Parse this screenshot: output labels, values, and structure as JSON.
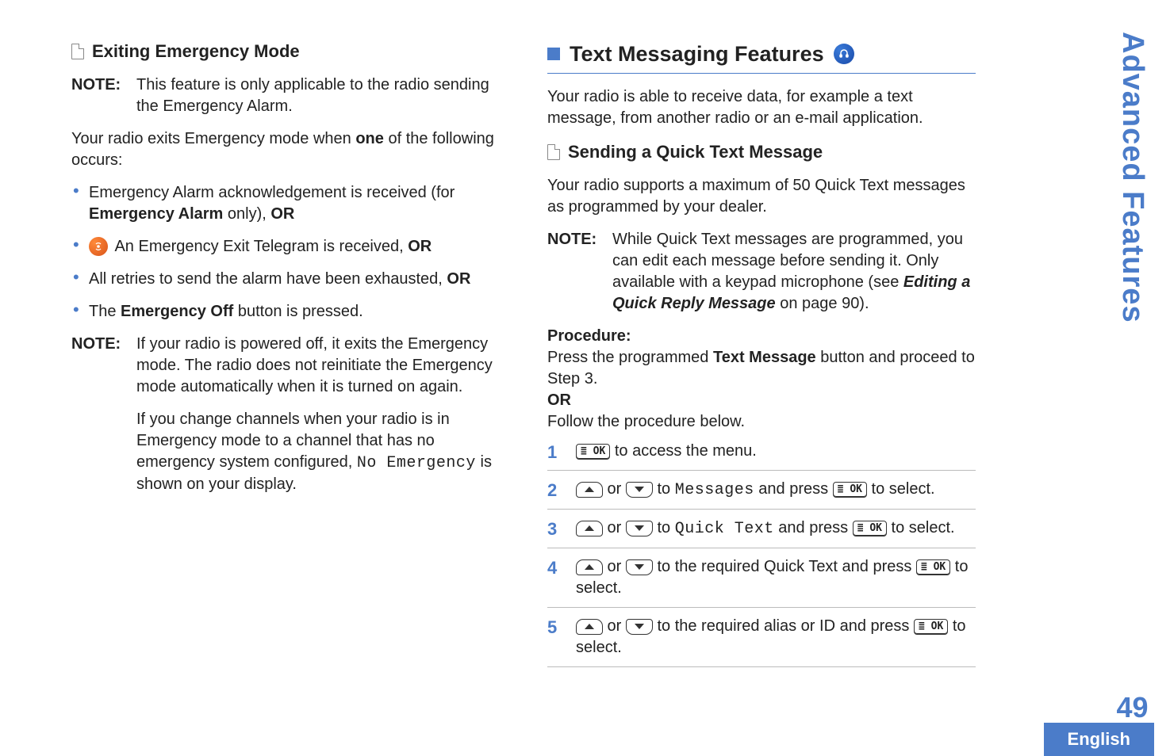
{
  "sidebar": {
    "section_label": "Advanced Features",
    "page_number": "49",
    "language": "English"
  },
  "left": {
    "heading": "Exiting Emergency Mode",
    "note1_label": "NOTE:",
    "note1_body": "This feature is only applicable to the radio sending the Emergency Alarm.",
    "intro_a": "Your radio exits Emergency mode when ",
    "intro_bold": "one",
    "intro_b": " of the following occurs:",
    "b1_a": "Emergency Alarm acknowledgement is received (for ",
    "b1_bold": "Emergency Alarm",
    "b1_b": " only), ",
    "b1_or": "OR",
    "b2_a": " An Emergency Exit Telegram is received, ",
    "b2_or": "OR",
    "b3_a": "All retries to send the alarm have been exhausted, ",
    "b3_or": "OR",
    "b4_a": "The ",
    "b4_bold": "Emergency Off",
    "b4_b": " button is pressed.",
    "note2_label": "NOTE:",
    "note2_p1": "If your radio is powered off, it exits the Emergency mode. The radio does not reinitiate the Emergency mode automatically when it is turned on again.",
    "note2_p2a": "If you change channels when your radio is in Emergency mode to a channel that has no emergency system configured, ",
    "note2_mono": "No Emergency",
    "note2_p2b": " is shown on your display."
  },
  "right": {
    "section_heading": "Text Messaging Features",
    "intro": "Your radio is able to receive data, for example a text message, from another radio or an e-mail application.",
    "sub_heading": "Sending a Quick Text Message",
    "sub_intro": "Your radio supports a maximum of 50 Quick Text messages as programmed by your dealer.",
    "note_label": "NOTE:",
    "note_a": "While Quick Text messages are programmed, you can edit each message before sending it. Only available with a keypad microphone (see ",
    "note_boldital": "Editing a Quick Reply Message",
    "note_b": " on page 90).",
    "proc_label": "Procedure:",
    "proc_a": "Press the programmed ",
    "proc_bold": "Text Message",
    "proc_b": " button and proceed to Step 3.",
    "proc_or": "OR",
    "proc_follow": "Follow the procedure below.",
    "ok_label": "≣ OK",
    "s1": " to access the menu.",
    "s2_a": " or ",
    "s2_b": " to ",
    "s2_mono": "Messages",
    "s2_c": " and press ",
    "s2_d": " to select.",
    "s3_a": " or ",
    "s3_b": " to ",
    "s3_mono": "Quick Text",
    "s3_c": " and press ",
    "s3_d": " to select.",
    "s4_a": " or ",
    "s4_b": " to the required Quick Text and press ",
    "s4_c": " to select.",
    "s5_a": " or ",
    "s5_b": " to the required alias or ID and press ",
    "s5_c": " to select."
  }
}
